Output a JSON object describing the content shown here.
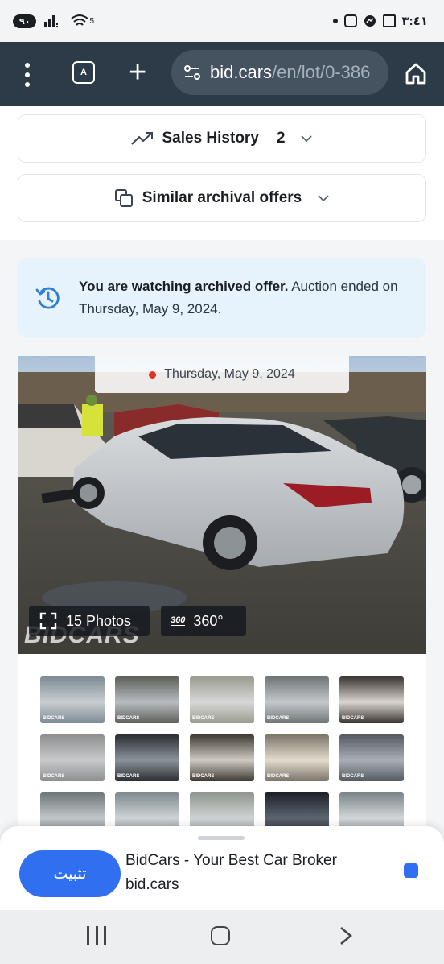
{
  "status_bar": {
    "battery": "٩٠",
    "signal_sup": "5",
    "time": "٣:٤١",
    "icons": [
      "signal-icon",
      "wifi-icon",
      "dot-icon",
      "instagram-icon",
      "messenger-icon",
      "screenshot-icon"
    ]
  },
  "toolbar": {
    "tabs_label": "A",
    "url_host": "bid.cars",
    "url_path": "/en/lot/0-386",
    "icons": [
      "menu-icon",
      "tabs-icon",
      "new-tab-icon",
      "site-settings-icon",
      "home-icon"
    ]
  },
  "sales_history": {
    "label": "Sales History",
    "count": "2"
  },
  "similar_offers": {
    "label": "Similar archival offers"
  },
  "notice": {
    "bold": "You are watching archived offer.",
    "rest": " Auction ended on Thursday, May 9, 2024."
  },
  "photo": {
    "date": "Thursday, May 9, 2024",
    "photos_label": "15 Photos",
    "deg_icon_label": "360",
    "deg_label": "360°",
    "watermark": "BIDCARS"
  },
  "thumbnails": {
    "watermark": "BIDCARS",
    "items": [
      {
        "color_a": "#7d8b94",
        "color_b": "#c9cdd1"
      },
      {
        "color_a": "#5e5f5a",
        "color_b": "#b8bcc0"
      },
      {
        "color_a": "#9a9c8e",
        "color_b": "#d6d7d8"
      },
      {
        "color_a": "#6f7575",
        "color_b": "#c4c8cc"
      },
      {
        "color_a": "#3a3532",
        "color_b": "#d9d4cf"
      },
      {
        "color_a": "#8d8f8f",
        "color_b": "#c7c9cb"
      },
      {
        "color_a": "#2b2e33",
        "color_b": "#8a9299"
      },
      {
        "color_a": "#403a35",
        "color_b": "#cfc9c2"
      },
      {
        "color_a": "#7a746a",
        "color_b": "#e3dccd"
      },
      {
        "color_a": "#545a60",
        "color_b": "#a9afb4"
      },
      {
        "color_a": "#6d7678",
        "color_b": "#c3c7ca"
      },
      {
        "color_a": "#7e8a8f",
        "color_b": "#cfd3d6"
      },
      {
        "color_a": "#8f958f",
        "color_b": "#d0d3d4"
      },
      {
        "color_a": "#1d2127",
        "color_b": "#5c6570"
      },
      {
        "color_a": "#7a8488",
        "color_b": "#d4d7d9"
      }
    ]
  },
  "install_banner": {
    "button": "تثبيت",
    "app_name": "BidCars - Your Best Car Broker",
    "app_host": "bid.cars"
  },
  "colors": {
    "toolbar": "#2d3a48",
    "accent_blue": "#2f6ff0",
    "notice_bg": "#e6f2fc",
    "live_red": "#e0312d"
  }
}
